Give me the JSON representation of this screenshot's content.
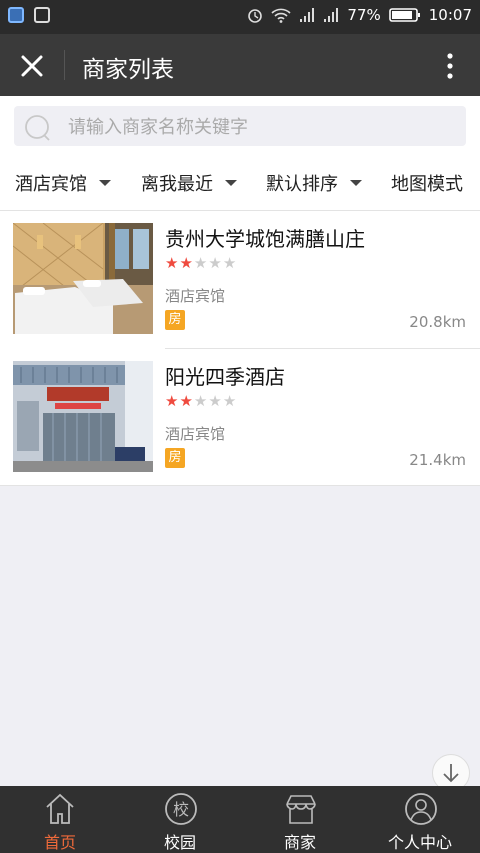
{
  "status": {
    "battery": "77%",
    "time": "10:07"
  },
  "header": {
    "title": "商家列表"
  },
  "search": {
    "placeholder": "请输入商家名称关键字"
  },
  "filters": [
    "酒店宾馆",
    "离我最近",
    "默认排序",
    "地图模式"
  ],
  "merchants": [
    {
      "name": "贵州大学城饱满膳山庄",
      "rating": 2,
      "category": "酒店宾馆",
      "badge": "房",
      "distance": "20.8km"
    },
    {
      "name": "阳光四季酒店",
      "rating": 2,
      "category": "酒店宾馆",
      "badge": "房",
      "distance": "21.4km"
    }
  ],
  "tabs": [
    {
      "label": "首页",
      "icon": "home-icon",
      "active": true
    },
    {
      "label": "校园",
      "icon": "campus-icon",
      "active": false
    },
    {
      "label": "商家",
      "icon": "shop-icon",
      "active": false
    },
    {
      "label": "个人中心",
      "icon": "user-icon",
      "active": false
    }
  ],
  "colors": {
    "accent": "#ef6a3a",
    "star": "#ef4b3f",
    "badge": "#f5a623",
    "titlebar": "#3a3a3a",
    "tabbar": "#303030"
  }
}
